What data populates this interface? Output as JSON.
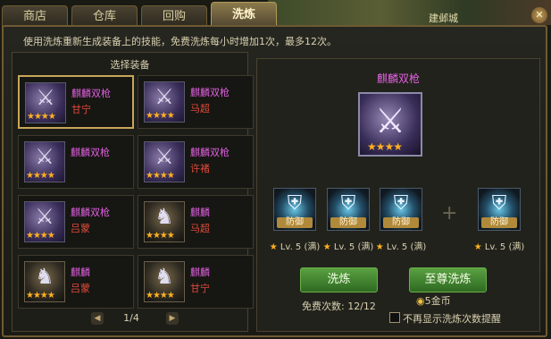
{
  "map": {
    "town_label": "建邺城",
    "close_icon": "close-icon",
    "close_glyph": "✕"
  },
  "tabs": [
    {
      "label": "商店",
      "active": false
    },
    {
      "label": "仓库",
      "active": false
    },
    {
      "label": "回购",
      "active": false
    },
    {
      "label": "洗炼",
      "active": true
    }
  ],
  "info_text": "使用洗炼重新生成装备上的技能，免费洗炼每小时增加1次，最多12次。",
  "left_panel": {
    "title": "选择装备",
    "items": [
      {
        "name": "麒麟双枪",
        "hero": "甘宁",
        "stars": "★★★★",
        "icon": "twin-spear-icon",
        "glyph": "⚔",
        "selected": true
      },
      {
        "name": "麒麟双枪",
        "hero": "马超",
        "stars": "★★★★",
        "icon": "twin-spear-icon",
        "glyph": "⚔",
        "selected": false
      },
      {
        "name": "麒麟双枪",
        "hero": "",
        "stars": "★★★★",
        "icon": "twin-spear-icon",
        "glyph": "⚔",
        "selected": false
      },
      {
        "name": "麒麟双枪",
        "hero": "许褚",
        "stars": "★★★★",
        "icon": "twin-spear-icon",
        "glyph": "⚔",
        "selected": false
      },
      {
        "name": "麒麟双枪",
        "hero": "吕蒙",
        "stars": "★★★★",
        "icon": "twin-spear-icon",
        "glyph": "⚔",
        "selected": false
      },
      {
        "name": "麒麟",
        "hero": "马超",
        "stars": "★★★★",
        "icon": "armored-warrior-icon",
        "glyph": "♞",
        "selected": false
      },
      {
        "name": "麒麟",
        "hero": "吕蒙",
        "stars": "★★★★",
        "icon": "armored-warrior-icon",
        "glyph": "♞",
        "selected": false
      },
      {
        "name": "麒麟",
        "hero": "甘宁",
        "stars": "★★★★",
        "icon": "armored-warrior-icon",
        "glyph": "♞",
        "selected": false
      }
    ],
    "pager": {
      "text": "1/4",
      "prev_glyph": "◀",
      "next_glyph": "▶"
    }
  },
  "right_panel": {
    "item_name": "麒麟双枪",
    "item_stars": "★★★★",
    "item_icon": "twin-spear-icon",
    "item_glyph": "⚔",
    "skills": [
      {
        "label": "防御",
        "level": "Lv. 5 (满)",
        "icon": "shield-icon",
        "glyph": "⛨"
      },
      {
        "label": "防御",
        "level": "Lv. 5 (满)",
        "icon": "shield-icon",
        "glyph": "⛨"
      },
      {
        "label": "防御",
        "level": "Lv. 5 (满)",
        "icon": "shield-icon",
        "glyph": "⛨"
      },
      {
        "label": "防御",
        "level": "Lv. 5 (满)",
        "icon": "shield-icon",
        "glyph": "⛨"
      }
    ],
    "plus": "+",
    "level_star": "★",
    "refine_button": "洗炼",
    "supreme_button": "至尊洗炼",
    "free_count": "免费次数: 12/12",
    "gold_cost": "5金币",
    "gold_icon": "gold-ingot-icon",
    "gold_glyph": "◉",
    "no_remind_label": "不再显示洗炼次数提醒"
  },
  "colors": {
    "item_name": "#e060e0",
    "hero_name": "#e04a3a",
    "star": "#ffb020",
    "button": "#4a9a38"
  }
}
